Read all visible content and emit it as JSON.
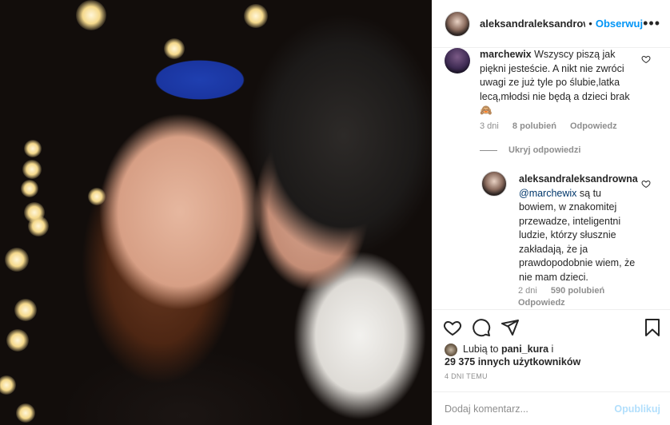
{
  "header": {
    "username": "aleksandraleksandrowı",
    "dot": "•",
    "follow_label": "Obserwuj",
    "more_label": "•••"
  },
  "comments": [
    {
      "user": "marchewix",
      "text": "Wszyscy piszą jak piękni jesteście. A nikt nie zwróci uwagi ze już tyle po ślubie,latka lecą,młodsi nie będą a dzieci brak",
      "emoji": "🙈",
      "age": "3 dni",
      "likes": "8 polubień",
      "reply": "Odpowiedz"
    }
  ],
  "hide_replies": "Ukryj odpowiedzi",
  "reply": {
    "user": "aleksandraleksandrowna",
    "mention": "@marchewix",
    "text": " są tu bowiem, w znakomitej przewadze, inteligentni ludzie, którzy słusznie zakładają, że ja prawdopodobnie wiem, że nie mam dzieci.",
    "age": "2 dni",
    "likes": "590 polubień",
    "reply_label": "Odpowiedz"
  },
  "likes": {
    "prefix": "Lubią to",
    "user": "pani_kura",
    "suffix": "i",
    "count": "29 375 innych użytkowników"
  },
  "date": "4 DNI TEMU",
  "add_comment": {
    "placeholder": "Dodaj komentarz...",
    "post_label": "Opublikuj"
  },
  "icons": [
    "heart-icon",
    "comment-icon",
    "share-icon",
    "bookmark-icon",
    "more-icon"
  ]
}
